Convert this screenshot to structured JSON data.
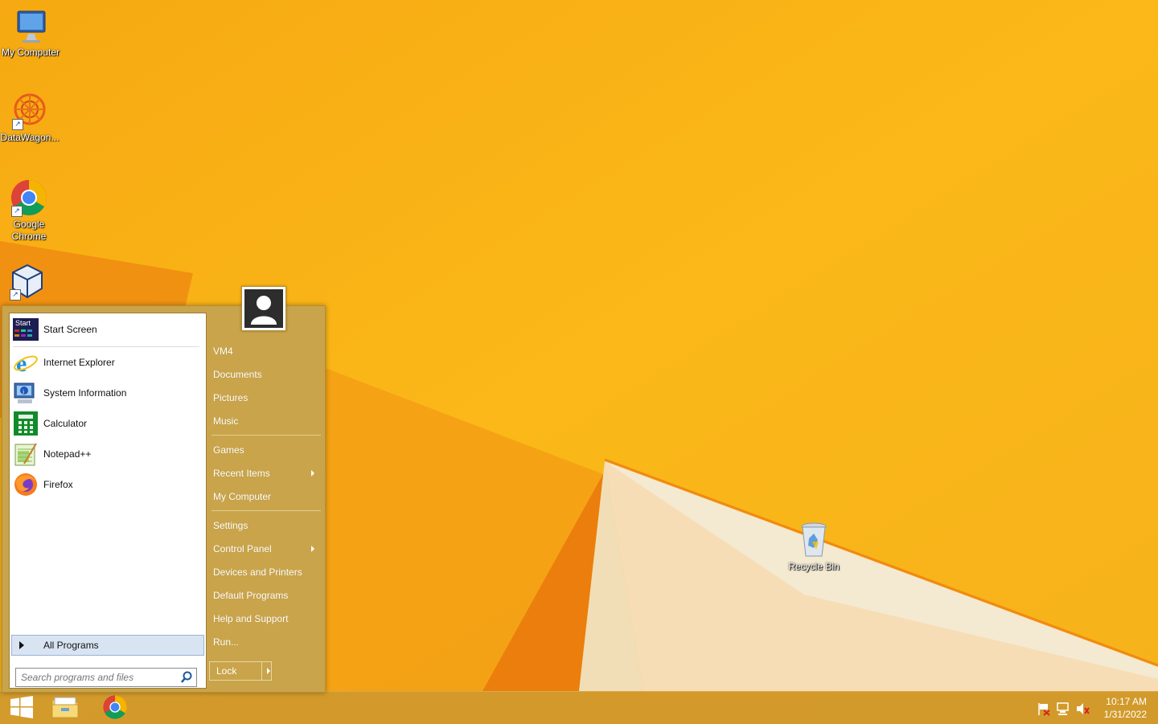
{
  "desktop": {
    "icons": [
      {
        "label": "My Computer",
        "icon": "computer-icon"
      },
      {
        "label": "DataWagon...",
        "icon": "datawagon-icon"
      },
      {
        "label": "Google Chrome",
        "icon": "chrome-icon"
      },
      {
        "label": "",
        "icon": "virtualbox-icon"
      },
      {
        "label": "Recycle Bin",
        "icon": "recycle-bin-icon"
      }
    ]
  },
  "start_menu": {
    "pinned": [
      {
        "label": "Start Screen",
        "icon": "start-screen-icon",
        "icon_text": "Start"
      },
      {
        "label": "Internet Explorer",
        "icon": "internet-explorer-icon"
      },
      {
        "label": "System Information",
        "icon": "system-information-icon"
      },
      {
        "label": "Calculator",
        "icon": "calculator-icon"
      },
      {
        "label": "Notepad++",
        "icon": "notepad-plus-plus-icon"
      },
      {
        "label": "Firefox",
        "icon": "firefox-icon"
      }
    ],
    "all_programs": "All Programs",
    "search_placeholder": "Search programs and files",
    "right_items": [
      {
        "label": "VM4",
        "submenu": false
      },
      {
        "label": "Documents",
        "submenu": false
      },
      {
        "label": "Pictures",
        "submenu": false
      },
      {
        "label": "Music",
        "submenu": false
      },
      {
        "label": "Games",
        "submenu": false
      },
      {
        "label": "Recent Items",
        "submenu": true
      },
      {
        "label": "My Computer",
        "submenu": false
      },
      {
        "label": "Settings",
        "submenu": false
      },
      {
        "label": "Control Panel",
        "submenu": true
      },
      {
        "label": "Devices and Printers",
        "submenu": false
      },
      {
        "label": "Default Programs",
        "submenu": false
      },
      {
        "label": "Help and Support",
        "submenu": false
      },
      {
        "label": "Run...",
        "submenu": false
      }
    ],
    "lock_label": "Lock"
  },
  "taskbar": {
    "apps": [
      {
        "name": "start",
        "icon": "windows-logo-icon"
      },
      {
        "name": "file-explorer",
        "icon": "folder-icon"
      },
      {
        "name": "chrome",
        "icon": "chrome-icon"
      }
    ],
    "tray": [
      {
        "icon": "action-center-flag-icon"
      },
      {
        "icon": "network-icon"
      },
      {
        "icon": "volume-muted-icon"
      }
    ],
    "time": "10:17 AM",
    "date": "1/31/2022"
  },
  "colors": {
    "wallpaper": "#f7b21a",
    "start_menu_bg": "#c9a44a",
    "taskbar": "#cd962d"
  }
}
